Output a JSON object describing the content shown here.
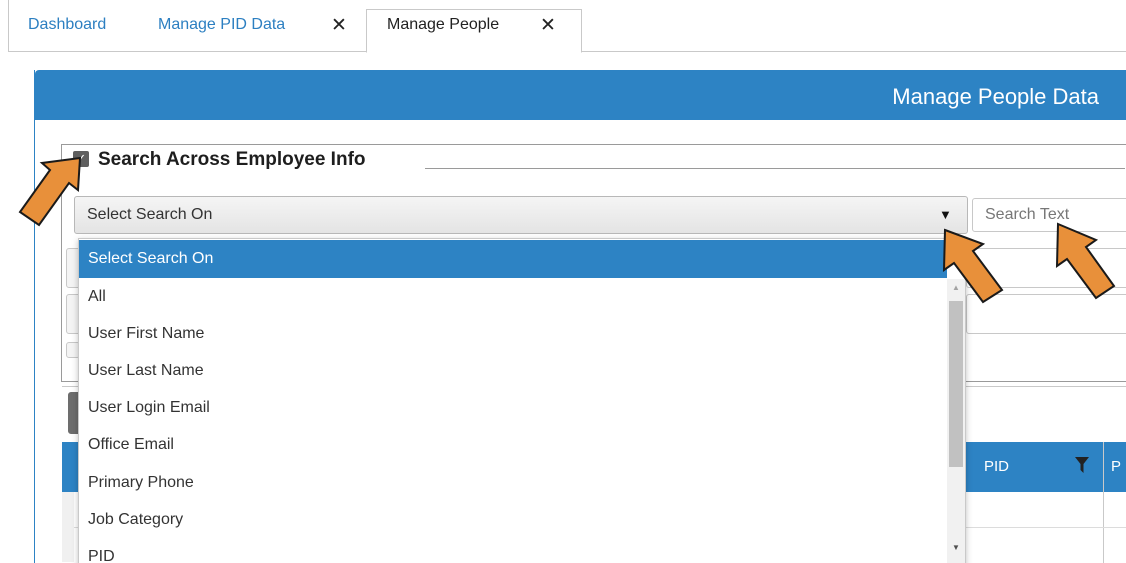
{
  "tabs": [
    {
      "label": "Dashboard"
    },
    {
      "label": "Manage PID Data"
    },
    {
      "label": "Manage People"
    }
  ],
  "tab_close_glyph": "✕",
  "panel": {
    "title": "Manage People Data"
  },
  "search": {
    "checkbox_checked": true,
    "legend": "Search Across Employee Info",
    "select_value": "Select Search On",
    "input_placeholder": "Search Text"
  },
  "dropdown": {
    "options": [
      "Select Search On",
      "All",
      "User First Name",
      "User Last Name",
      "User Login Email",
      "Office Email",
      "Primary Phone",
      "Job Category",
      "PID"
    ]
  },
  "grid": {
    "headers": [
      "PID",
      "P"
    ]
  },
  "colors": {
    "accent": "#2d83c4",
    "tab_link": "#2c7fc1",
    "annotation_arrow": "#e8903a"
  },
  "icons": {
    "close": "close-icon",
    "dropdown": "chevron-down-icon",
    "filter": "filter-icon",
    "checkbox": "checkbox-checked-icon"
  }
}
